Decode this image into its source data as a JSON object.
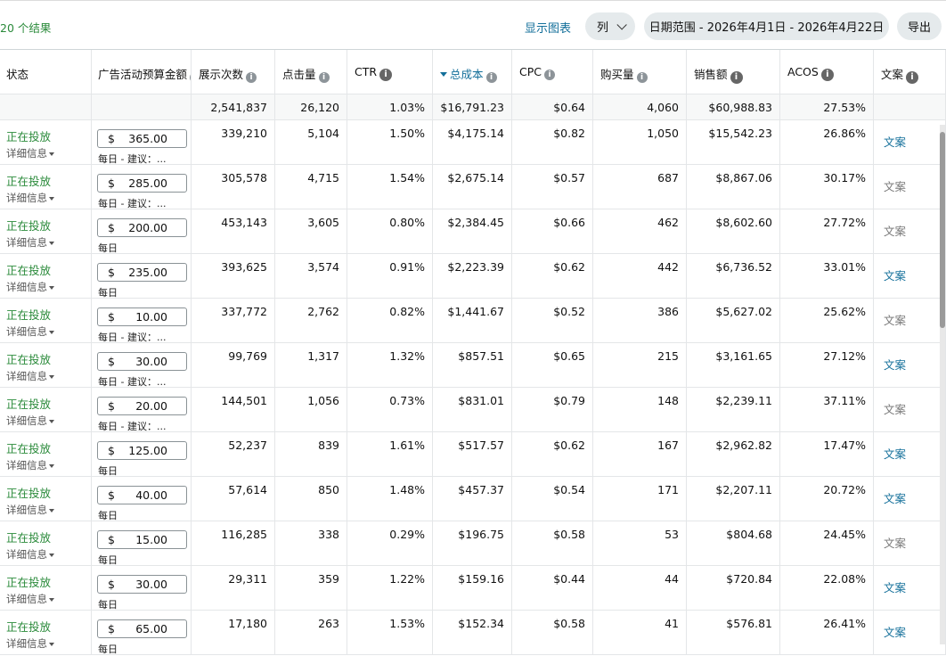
{
  "toolbar": {
    "result_count": "20 个结果",
    "show_chart": "显示图表",
    "columns": "列",
    "date_range": "日期范围 - 2026年4月1日 - 2026年4月22日",
    "export": "导出"
  },
  "columns": [
    {
      "key": "status",
      "label": "状态",
      "info": false
    },
    {
      "key": "budget",
      "label": "广告活动预算金额",
      "info": true
    },
    {
      "key": "impressions",
      "label": "展示次数",
      "info": true
    },
    {
      "key": "clicks",
      "label": "点击量",
      "info": true
    },
    {
      "key": "ctr",
      "label": "CTR",
      "info": true
    },
    {
      "key": "cost",
      "label": "总成本",
      "info": true,
      "sorted": true
    },
    {
      "key": "cpc",
      "label": "CPC",
      "info": true
    },
    {
      "key": "orders",
      "label": "购买量",
      "info": true
    },
    {
      "key": "sales",
      "label": "销售额",
      "info": true
    },
    {
      "key": "acos",
      "label": "ACOS",
      "info": true
    },
    {
      "key": "copy",
      "label": "文案",
      "info": true
    }
  ],
  "summary": {
    "impressions": "2,541,837",
    "clicks": "26,120",
    "ctr": "1.03%",
    "cost": "$16,791.23",
    "cpc": "$0.64",
    "orders": "4,060",
    "sales": "$60,988.83",
    "acos": "27.53%"
  },
  "status_text": "正在投放",
  "details_text": "详细信息",
  "currency_symbol": "$",
  "rows": [
    {
      "budget": "365.00",
      "sub": "每日 - 建议：...",
      "impressions": "339,210",
      "clicks": "5,104",
      "ctr": "1.50%",
      "cost": "$4,175.14",
      "cpc": "$0.82",
      "orders": "1,050",
      "sales": "$15,542.23",
      "acos": "26.86%",
      "copy": "文案",
      "copy_active": true
    },
    {
      "budget": "285.00",
      "sub": "每日 - 建议：...",
      "impressions": "305,578",
      "clicks": "4,715",
      "ctr": "1.54%",
      "cost": "$2,675.14",
      "cpc": "$0.57",
      "orders": "687",
      "sales": "$8,867.06",
      "acos": "30.17%",
      "copy": "文案",
      "copy_active": false
    },
    {
      "budget": "200.00",
      "sub": "每日",
      "impressions": "453,143",
      "clicks": "3,605",
      "ctr": "0.80%",
      "cost": "$2,384.45",
      "cpc": "$0.66",
      "orders": "462",
      "sales": "$8,602.60",
      "acos": "27.72%",
      "copy": "文案",
      "copy_active": false
    },
    {
      "budget": "235.00",
      "sub": "每日",
      "impressions": "393,625",
      "clicks": "3,574",
      "ctr": "0.91%",
      "cost": "$2,223.39",
      "cpc": "$0.62",
      "orders": "442",
      "sales": "$6,736.52",
      "acos": "33.01%",
      "copy": "文案",
      "copy_active": true
    },
    {
      "budget": "10.00",
      "sub": "每日 - 建议：...",
      "impressions": "337,772",
      "clicks": "2,762",
      "ctr": "0.82%",
      "cost": "$1,441.67",
      "cpc": "$0.52",
      "orders": "386",
      "sales": "$5,627.02",
      "acos": "25.62%",
      "copy": "文案",
      "copy_active": false
    },
    {
      "budget": "30.00",
      "sub": "每日 - 建议：...",
      "impressions": "99,769",
      "clicks": "1,317",
      "ctr": "1.32%",
      "cost": "$857.51",
      "cpc": "$0.65",
      "orders": "215",
      "sales": "$3,161.65",
      "acos": "27.12%",
      "copy": "文案",
      "copy_active": true
    },
    {
      "budget": "20.00",
      "sub": "每日 - 建议：...",
      "impressions": "144,501",
      "clicks": "1,056",
      "ctr": "0.73%",
      "cost": "$831.01",
      "cpc": "$0.79",
      "orders": "148",
      "sales": "$2,239.11",
      "acos": "37.11%",
      "copy": "文案",
      "copy_active": false
    },
    {
      "budget": "125.00",
      "sub": "每日",
      "impressions": "52,237",
      "clicks": "839",
      "ctr": "1.61%",
      "cost": "$517.57",
      "cpc": "$0.62",
      "orders": "167",
      "sales": "$2,962.82",
      "acos": "17.47%",
      "copy": "文案",
      "copy_active": true
    },
    {
      "budget": "40.00",
      "sub": "每日",
      "impressions": "57,614",
      "clicks": "850",
      "ctr": "1.48%",
      "cost": "$457.37",
      "cpc": "$0.54",
      "orders": "171",
      "sales": "$2,207.11",
      "acos": "20.72%",
      "copy": "文案",
      "copy_active": true
    },
    {
      "budget": "15.00",
      "sub": "每日",
      "impressions": "116,285",
      "clicks": "338",
      "ctr": "0.29%",
      "cost": "$196.75",
      "cpc": "$0.58",
      "orders": "53",
      "sales": "$804.68",
      "acos": "24.45%",
      "copy": "文案",
      "copy_active": false
    },
    {
      "budget": "30.00",
      "sub": "每日",
      "impressions": "29,311",
      "clicks": "359",
      "ctr": "1.22%",
      "cost": "$159.16",
      "cpc": "$0.44",
      "orders": "44",
      "sales": "$720.84",
      "acos": "22.08%",
      "copy": "文案",
      "copy_active": true
    },
    {
      "budget": "65.00",
      "sub": "每日",
      "impressions": "17,180",
      "clicks": "263",
      "ctr": "1.53%",
      "cost": "$152.34",
      "cpc": "$0.58",
      "orders": "41",
      "sales": "$576.81",
      "acos": "26.41%",
      "copy": "文案",
      "copy_active": true
    }
  ]
}
